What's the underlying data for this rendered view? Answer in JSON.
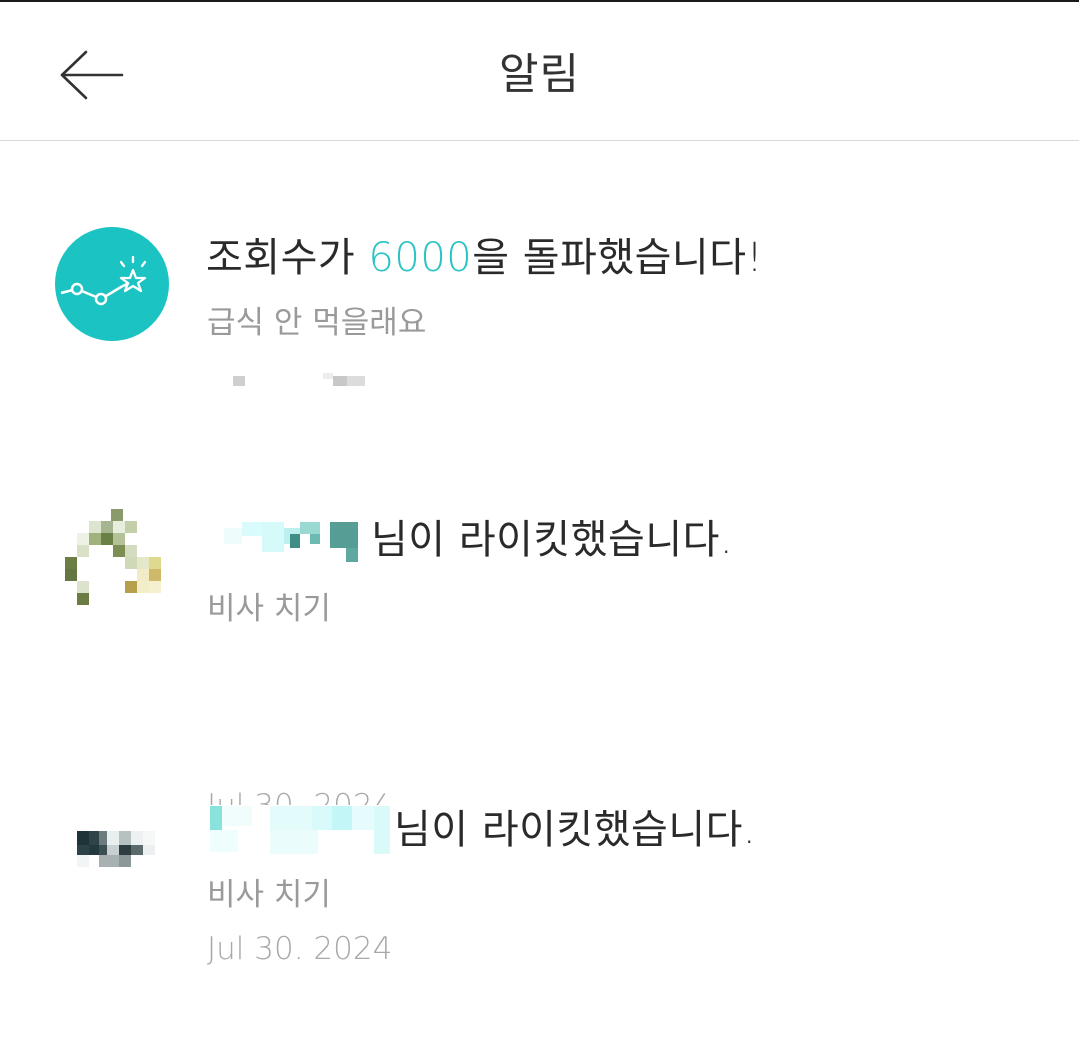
{
  "header": {
    "title": "알림",
    "back_icon": "arrow-left-icon"
  },
  "notifications": [
    {
      "icon": "stats-star-icon",
      "title_prefix": "조회수가 ",
      "title_highlight": "6000",
      "title_suffix": "을 돌파했습니다!",
      "subtitle": "급식 안 먹을래요",
      "date": ""
    },
    {
      "icon": "user-avatar",
      "title_suffix": "님이 라이킷했습니다.",
      "subtitle": "비사 치기",
      "date": "Jul 30. 2024"
    },
    {
      "icon": "user-avatar",
      "title_suffix": "님이 라이킷했습니다.",
      "subtitle": "비사 치기",
      "date": "Jul 30. 2024"
    }
  ],
  "colors": {
    "accent": "#1cc3c3",
    "highlight_text": "#29c3c4",
    "secondary_text": "#9a9a9a"
  }
}
